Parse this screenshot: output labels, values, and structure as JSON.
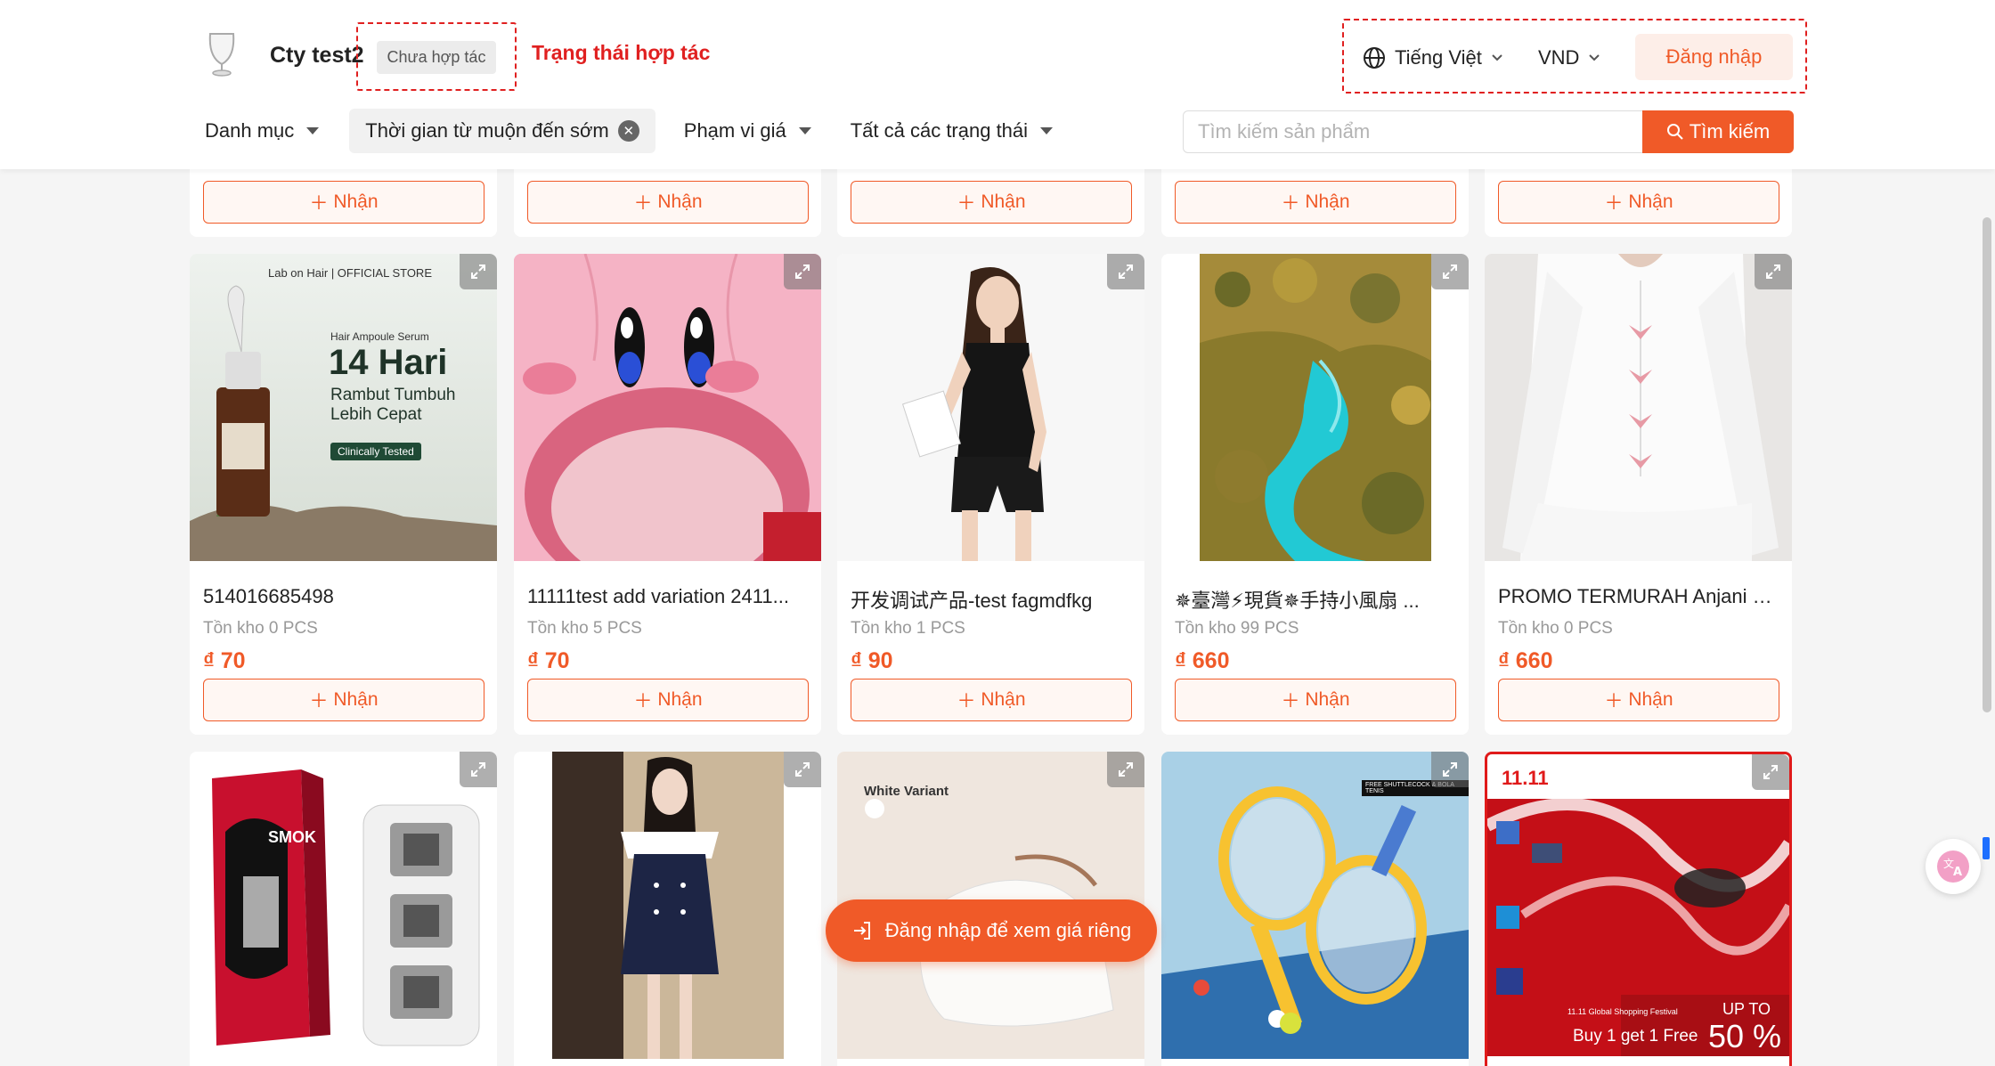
{
  "header": {
    "company_name": "Cty test2",
    "coop_status": "Chưa hợp tác",
    "coop_annotation": "Trạng thái hợp tác",
    "language": "Tiếng Việt",
    "currency": "VND",
    "login_label": "Đăng nhập"
  },
  "filters": {
    "category": "Danh mục",
    "sort": "Thời gian từ muộn đến sớm",
    "price_range": "Phạm vi giá",
    "status": "Tất cả các trạng thái"
  },
  "search": {
    "placeholder": "Tìm kiếm sản phẩm",
    "button": "Tìm kiếm"
  },
  "products": {
    "get_label": "Nhận",
    "row1": [
      {
        "name": "514016685498",
        "stock": "Tồn kho 0 PCS",
        "price": "₫ 70",
        "image": "hair-serum"
      },
      {
        "name": "11111test add variation 2411...",
        "stock": "Tồn kho 5 PCS",
        "price": "₫ 70",
        "image": "pink-kirby"
      },
      {
        "name": "开发调试产品-test fagmdfkg",
        "stock": "Tồn kho 1 PCS",
        "price": "₫ 90",
        "image": "woman-black-outfit"
      },
      {
        "name": "✵臺灣⚡現貨✵手持小風扇 ...",
        "stock": "Tồn kho 99 PCS",
        "price": "₫ 660",
        "image": "river-forest"
      },
      {
        "name": "PROMO TERMURAH Anjani D...",
        "stock": "Tồn kho 0 PCS",
        "price": "₫ 660",
        "image": "white-blouse"
      }
    ],
    "row2_images": [
      "smok-coils",
      "sailor-dress",
      "white-shoes",
      "badminton-rackets",
      "sale-banner"
    ]
  },
  "image_text": {
    "hair_brand": "Lab on Hair | OFFICIAL STORE",
    "hair_line1": "Hair Ampoule Serum",
    "hair_line2": "14 Hari",
    "hair_line3": "Rambut Tumbuh",
    "hair_line4": "Lebih Cepat",
    "hair_badge": "Clinically Tested",
    "smok": "SMOK",
    "shoe_variant": "White Variant",
    "racket_tag": "FREE SHUTTLECOCK & BOLA TENIS",
    "sale_1111": "11.11",
    "sale_up_to": "UP TO",
    "sale_pct": "50 %",
    "sale_buy": "Buy 1 get 1 Free",
    "sale_festival": "11.11 Global Shopping Festival"
  },
  "float_login": "Đăng nhập để xem giá riêng",
  "colors": {
    "accent": "#f05a28",
    "annotation": "#e02020"
  }
}
